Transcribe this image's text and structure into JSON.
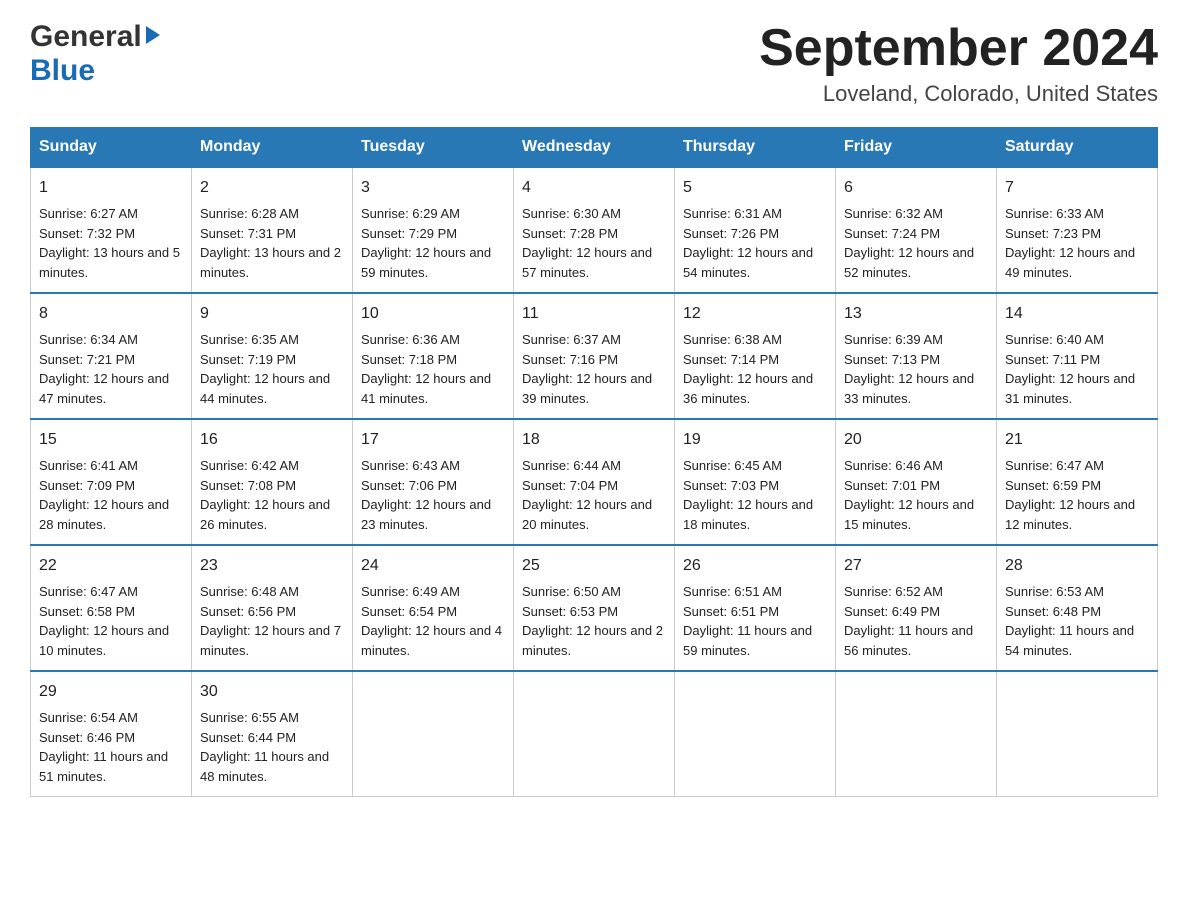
{
  "header": {
    "logo_general": "General",
    "logo_blue": "Blue",
    "month_year": "September 2024",
    "location": "Loveland, Colorado, United States"
  },
  "days_of_week": [
    "Sunday",
    "Monday",
    "Tuesday",
    "Wednesday",
    "Thursday",
    "Friday",
    "Saturday"
  ],
  "weeks": [
    [
      {
        "day": "1",
        "sunrise": "6:27 AM",
        "sunset": "7:32 PM",
        "daylight": "13 hours and 5 minutes."
      },
      {
        "day": "2",
        "sunrise": "6:28 AM",
        "sunset": "7:31 PM",
        "daylight": "13 hours and 2 minutes."
      },
      {
        "day": "3",
        "sunrise": "6:29 AM",
        "sunset": "7:29 PM",
        "daylight": "12 hours and 59 minutes."
      },
      {
        "day": "4",
        "sunrise": "6:30 AM",
        "sunset": "7:28 PM",
        "daylight": "12 hours and 57 minutes."
      },
      {
        "day": "5",
        "sunrise": "6:31 AM",
        "sunset": "7:26 PM",
        "daylight": "12 hours and 54 minutes."
      },
      {
        "day": "6",
        "sunrise": "6:32 AM",
        "sunset": "7:24 PM",
        "daylight": "12 hours and 52 minutes."
      },
      {
        "day": "7",
        "sunrise": "6:33 AM",
        "sunset": "7:23 PM",
        "daylight": "12 hours and 49 minutes."
      }
    ],
    [
      {
        "day": "8",
        "sunrise": "6:34 AM",
        "sunset": "7:21 PM",
        "daylight": "12 hours and 47 minutes."
      },
      {
        "day": "9",
        "sunrise": "6:35 AM",
        "sunset": "7:19 PM",
        "daylight": "12 hours and 44 minutes."
      },
      {
        "day": "10",
        "sunrise": "6:36 AM",
        "sunset": "7:18 PM",
        "daylight": "12 hours and 41 minutes."
      },
      {
        "day": "11",
        "sunrise": "6:37 AM",
        "sunset": "7:16 PM",
        "daylight": "12 hours and 39 minutes."
      },
      {
        "day": "12",
        "sunrise": "6:38 AM",
        "sunset": "7:14 PM",
        "daylight": "12 hours and 36 minutes."
      },
      {
        "day": "13",
        "sunrise": "6:39 AM",
        "sunset": "7:13 PM",
        "daylight": "12 hours and 33 minutes."
      },
      {
        "day": "14",
        "sunrise": "6:40 AM",
        "sunset": "7:11 PM",
        "daylight": "12 hours and 31 minutes."
      }
    ],
    [
      {
        "day": "15",
        "sunrise": "6:41 AM",
        "sunset": "7:09 PM",
        "daylight": "12 hours and 28 minutes."
      },
      {
        "day": "16",
        "sunrise": "6:42 AM",
        "sunset": "7:08 PM",
        "daylight": "12 hours and 26 minutes."
      },
      {
        "day": "17",
        "sunrise": "6:43 AM",
        "sunset": "7:06 PM",
        "daylight": "12 hours and 23 minutes."
      },
      {
        "day": "18",
        "sunrise": "6:44 AM",
        "sunset": "7:04 PM",
        "daylight": "12 hours and 20 minutes."
      },
      {
        "day": "19",
        "sunrise": "6:45 AM",
        "sunset": "7:03 PM",
        "daylight": "12 hours and 18 minutes."
      },
      {
        "day": "20",
        "sunrise": "6:46 AM",
        "sunset": "7:01 PM",
        "daylight": "12 hours and 15 minutes."
      },
      {
        "day": "21",
        "sunrise": "6:47 AM",
        "sunset": "6:59 PM",
        "daylight": "12 hours and 12 minutes."
      }
    ],
    [
      {
        "day": "22",
        "sunrise": "6:47 AM",
        "sunset": "6:58 PM",
        "daylight": "12 hours and 10 minutes."
      },
      {
        "day": "23",
        "sunrise": "6:48 AM",
        "sunset": "6:56 PM",
        "daylight": "12 hours and 7 minutes."
      },
      {
        "day": "24",
        "sunrise": "6:49 AM",
        "sunset": "6:54 PM",
        "daylight": "12 hours and 4 minutes."
      },
      {
        "day": "25",
        "sunrise": "6:50 AM",
        "sunset": "6:53 PM",
        "daylight": "12 hours and 2 minutes."
      },
      {
        "day": "26",
        "sunrise": "6:51 AM",
        "sunset": "6:51 PM",
        "daylight": "11 hours and 59 minutes."
      },
      {
        "day": "27",
        "sunrise": "6:52 AM",
        "sunset": "6:49 PM",
        "daylight": "11 hours and 56 minutes."
      },
      {
        "day": "28",
        "sunrise": "6:53 AM",
        "sunset": "6:48 PM",
        "daylight": "11 hours and 54 minutes."
      }
    ],
    [
      {
        "day": "29",
        "sunrise": "6:54 AM",
        "sunset": "6:46 PM",
        "daylight": "11 hours and 51 minutes."
      },
      {
        "day": "30",
        "sunrise": "6:55 AM",
        "sunset": "6:44 PM",
        "daylight": "11 hours and 48 minutes."
      },
      null,
      null,
      null,
      null,
      null
    ]
  ],
  "labels": {
    "sunrise": "Sunrise: ",
    "sunset": "Sunset: ",
    "daylight": "Daylight: "
  }
}
